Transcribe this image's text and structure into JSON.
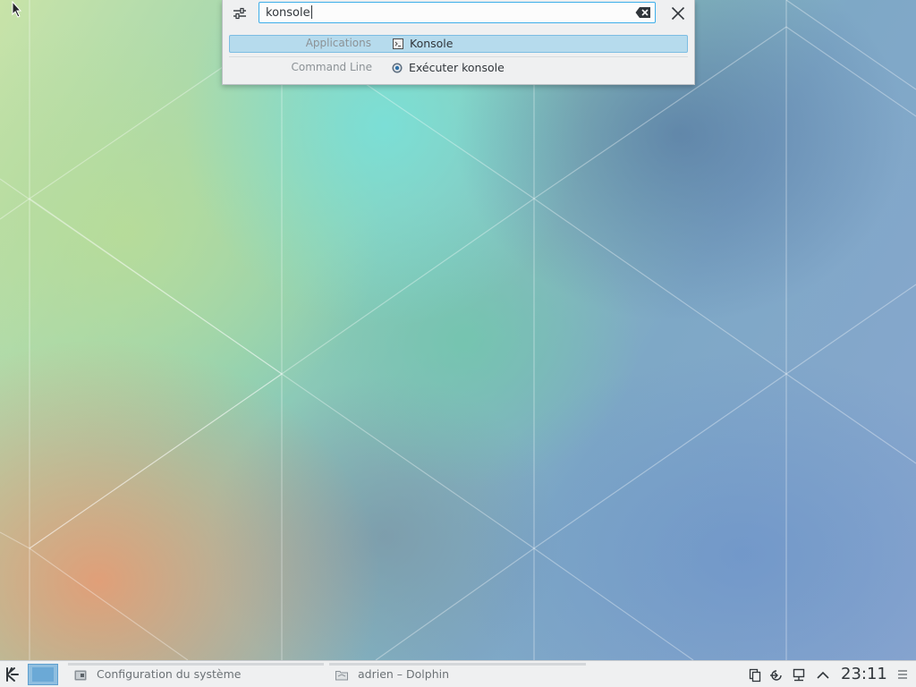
{
  "krunner": {
    "query": "konsole",
    "results": [
      {
        "category": "Applications",
        "title": "Konsole",
        "icon": "terminal-icon",
        "selected": true
      },
      {
        "category": "Command Line",
        "title": "Exécuter konsole",
        "icon": "run-command-icon",
        "selected": false
      }
    ]
  },
  "taskbar": {
    "tasks": [
      {
        "label": "Configuration du système",
        "icon": "system-settings-icon"
      },
      {
        "label": "adrien – Dolphin",
        "icon": "folder-icon"
      }
    ],
    "tray_icons": [
      "clipboard-icon",
      "updates-icon",
      "network-icon",
      "show-hidden-icon"
    ],
    "clock": "23:11"
  },
  "colors": {
    "accent": "#3daee9",
    "selection": "#b6dbed",
    "panel_bg": "#eff0f1",
    "text": "#31363b",
    "muted_text": "#8c9296"
  }
}
